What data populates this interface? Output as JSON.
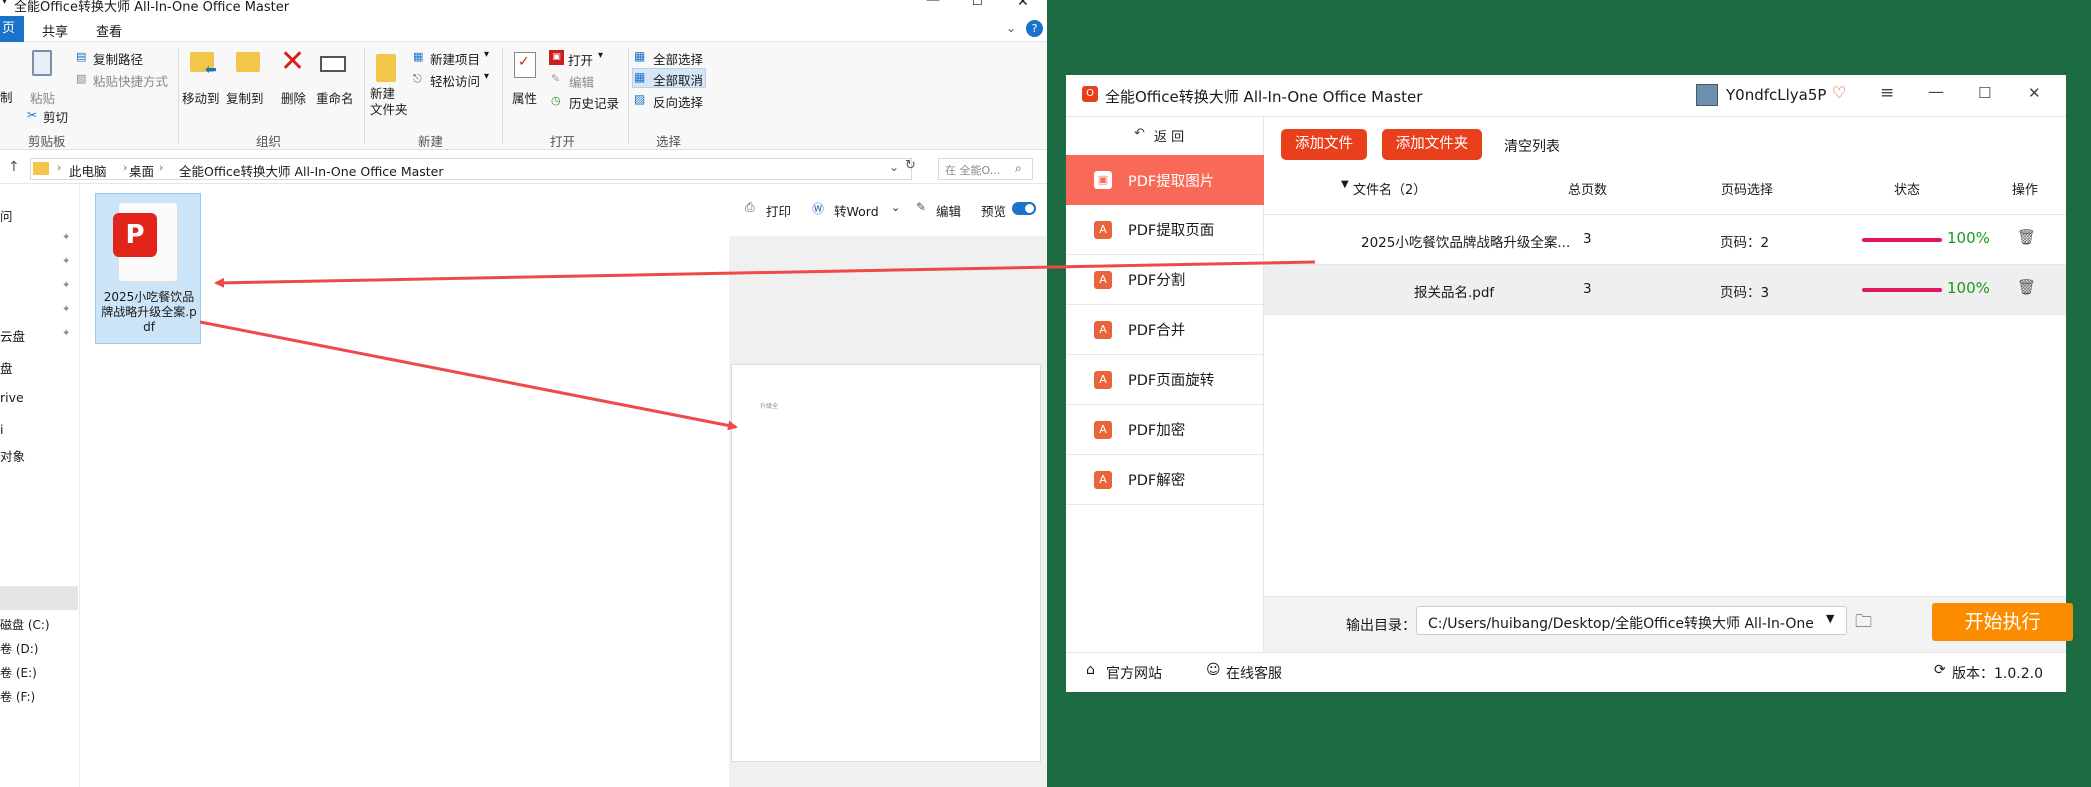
{
  "explorer": {
    "title": "全能Office转换大师 All-In-One Office Master",
    "tabs": [
      "页",
      "共享",
      "查看"
    ],
    "ribbon": {
      "clipboard_group": "剪贴板",
      "cut_partial": "制",
      "paste": "粘贴",
      "copy_path": "复制路径",
      "paste_shortcut": "粘贴快捷方式",
      "cut": "剪切",
      "organize_group": "组织",
      "move_to": "移动到",
      "copy_to": "复制到",
      "delete": "删除",
      "rename": "重命名",
      "new_group": "新建",
      "new_folder": "新建\n文件夹",
      "new_item": "新建项目",
      "easy_access": "轻松访问",
      "open_group": "打开",
      "properties": "属性",
      "open": "打开",
      "edit": "编辑",
      "history": "历史记录",
      "select_group": "选择",
      "select_all": "全部选择",
      "select_none": "全部取消",
      "invert_select": "反向选择"
    },
    "breadcrumb": [
      "此电脑",
      "桌面",
      "全能Office转换大师 All-In-One Office Master"
    ],
    "search_placeholder": "在 全能O...",
    "nav_items": [
      "问",
      "云盘",
      "盘",
      "rive",
      "i",
      "对象",
      "磁盘 (C:)",
      "卷 (D:)",
      "卷 (E:)",
      "卷 (F:)"
    ],
    "file_name": "2025小吃餐饮品牌战略升级全案.pdf",
    "preview_toolbar": {
      "print": "打印",
      "to_word": "转Word",
      "edit": "编辑",
      "preview": "预览"
    },
    "preview_page_text": "升级全"
  },
  "app": {
    "title": "全能Office转换大师 All-In-One Office Master",
    "username": "Y0ndfcLlya5P",
    "back": "返 回",
    "sidebar": [
      {
        "label": "PDF提取图片",
        "active": true
      },
      {
        "label": "PDF提取页面",
        "active": false
      },
      {
        "label": "PDF分割",
        "active": false
      },
      {
        "label": "PDF合并",
        "active": false
      },
      {
        "label": "PDF页面旋转",
        "active": false
      },
      {
        "label": "PDF加密",
        "active": false
      },
      {
        "label": "PDF解密",
        "active": false
      }
    ],
    "add_file": "添加文件",
    "add_folder": "添加文件夹",
    "clear_list": "清空列表",
    "columns": {
      "name": "文件名（2）",
      "pages": "总页数",
      "page_select": "页码选择",
      "status": "状态",
      "action": "操作"
    },
    "rows": [
      {
        "name": "2025小吃餐饮品牌战略升级全案...",
        "pages": "3",
        "page_select": "页码：2",
        "progress": 1.0,
        "status": "100%"
      },
      {
        "name": "报关品名.pdf",
        "pages": "3",
        "page_select": "页码：3",
        "progress": 1.0,
        "status": "100%"
      }
    ],
    "output_label": "输出目录：",
    "output_path": "C:/Users/huibang/Desktop/全能Office转换大师 All-In-One",
    "start": "开始执行",
    "official_site": "官方网站",
    "online_service": "在线客服",
    "version": "版本：1.0.2.0"
  },
  "colors": {
    "accent": "#e8401d",
    "active_sidebar": "#f86a57",
    "start": "#fb8c00",
    "progress": "#e0185e",
    "success": "#1a9a1a",
    "background": "#1d6b42",
    "arrow": "#ee4a4a"
  }
}
